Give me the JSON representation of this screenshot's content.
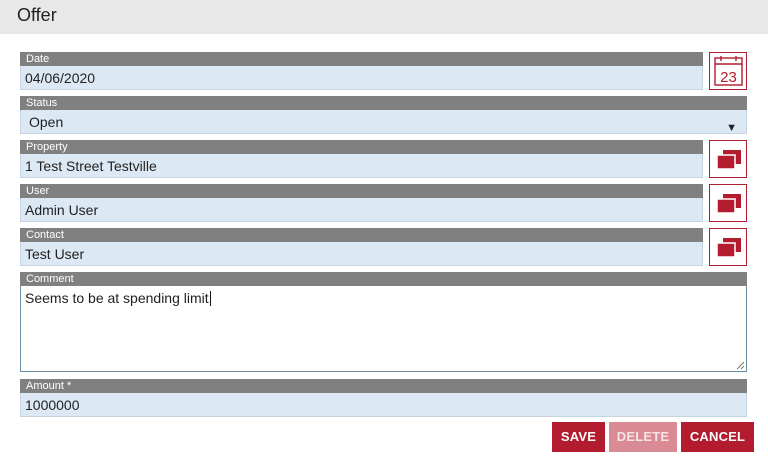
{
  "header": {
    "title": "Offer"
  },
  "fields": {
    "date": {
      "label": "Date",
      "value": "04/06/2020"
    },
    "status": {
      "label": "Status",
      "value": "Open"
    },
    "property": {
      "label": "Property",
      "value": "1 Test Street Testville"
    },
    "user": {
      "label": "User",
      "value": "Admin User"
    },
    "contact": {
      "label": "Contact",
      "value": "Test User"
    },
    "comment": {
      "label": "Comment",
      "value": "Seems to be at spending limit"
    },
    "amount": {
      "label": "Amount *",
      "value": "1000000"
    }
  },
  "calendar": {
    "day": "23",
    "icon": "calendar-icon"
  },
  "lookup_icon": "lookup-windows-icon",
  "buttons": {
    "save": "SAVE",
    "delete": "DELETE",
    "cancel": "CANCEL"
  },
  "colors": {
    "accent": "#b31b2e",
    "accent_disabled": "#d98a92",
    "label_bg": "#808080",
    "field_bg": "#dce8f4",
    "header_bg": "#e8e8e8"
  }
}
